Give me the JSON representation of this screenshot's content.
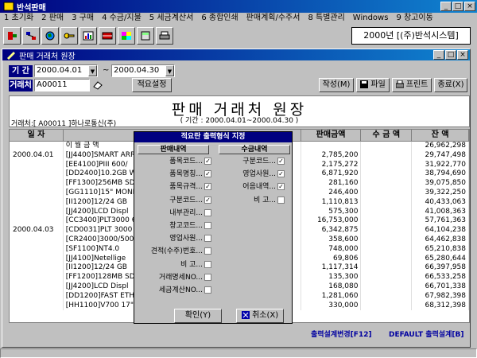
{
  "app": {
    "title": "반석판매"
  },
  "menu": [
    "1 초기화",
    "2 판매",
    "3 구매",
    "4 수금/지불",
    "5 세금계산서",
    "6 종합인쇄",
    "판매계획/수주서",
    "8 특별관리",
    "Windows",
    "9 창고이동"
  ],
  "toolbar_icons": [
    "exit-icon",
    "network-icon",
    "globe-icon",
    "key-icon",
    "chart-icon",
    "register-icon",
    "puzzle-icon",
    "calculator-icon",
    "printer-icon"
  ],
  "company": "2000년 [(주)반석시스템]",
  "window": {
    "title": "판매 거래처 원장"
  },
  "filter": {
    "period_label": "기 간",
    "customer_label": "거래처",
    "date_from": "2000.04.01",
    "tilde": "~",
    "date_to": "2000.04.30",
    "customer_code": "A00011",
    "summary_button": "적요설정"
  },
  "actions": {
    "create": "작성(M)",
    "file": "파일",
    "print": "프린트",
    "exit": "종료(X)"
  },
  "report": {
    "title": "판매 거래처 원장",
    "subtitle": "( 기간 : 2000.04.01~2000.04.30 )",
    "customer": "거래처:[ A00011 ]하나로통신(주)"
  },
  "grid": {
    "headers": [
      "일 자",
      "",
      "판매금액",
      "수 금 액",
      "잔 액"
    ],
    "rows": [
      {
        "date": "",
        "desc": "이 월 금 액",
        "sale": "",
        "paid": "",
        "balance": "26,962,298"
      },
      {
        "date": "2000.04.01",
        "desc": "[JJ4400]SMART ARR",
        "sale": "2,785,200",
        "paid": "",
        "balance": "29,747,498"
      },
      {
        "date": "",
        "desc": "[EE4100]PIII 600/",
        "sale": "2,175,272",
        "paid": "",
        "balance": "31,922,770"
      },
      {
        "date": "",
        "desc": "[DD2400]10.2GB WUL",
        "sale": "6,871,920",
        "paid": "",
        "balance": "38,794,690"
      },
      {
        "date": "",
        "desc": "[FF1300]256MB SDR",
        "sale": "281,160",
        "paid": "",
        "balance": "39,075,850"
      },
      {
        "date": "",
        "desc": "[GG1110]15\" MONIT",
        "sale": "246,400",
        "paid": "",
        "balance": "39,322,250"
      },
      {
        "date": "",
        "desc": "[II1200]12/24 GB",
        "sale": "1,110,813",
        "paid": "",
        "balance": "40,433,063"
      },
      {
        "date": "",
        "desc": "[JJ4200]LCD Displ",
        "sale": "575,300",
        "paid": "",
        "balance": "41,008,363"
      },
      {
        "date": "",
        "desc": "[CC3400]PLT3000 6",
        "sale": "16,753,000",
        "paid": "",
        "balance": "57,761,363"
      },
      {
        "date": "2000.04.03",
        "desc": "[CD0031]PLT 3000",
        "sale": "6,342,875",
        "paid": "",
        "balance": "64,104,238"
      },
      {
        "date": "",
        "desc": "[CR2400]3000/5000",
        "sale": "358,600",
        "paid": "",
        "balance": "64,462,838"
      },
      {
        "date": "",
        "desc": "[SF1100]NT4.0",
        "sale": "748,000",
        "paid": "",
        "balance": "65,210,838"
      },
      {
        "date": "",
        "desc": "[JJ4100]Netellige",
        "sale": "69,806",
        "paid": "",
        "balance": "65,280,644"
      },
      {
        "date": "",
        "desc": "[II1200]12/24 GB",
        "sale": "1,117,314",
        "paid": "",
        "balance": "66,397,958"
      },
      {
        "date": "",
        "desc": "[FF1200]128MB SDR",
        "sale": "135,300",
        "paid": "",
        "balance": "66,533,258"
      },
      {
        "date": "",
        "desc": "[JJ4200]LCD Displ",
        "sale": "168,080",
        "paid": "",
        "balance": "66,701,338"
      },
      {
        "date": "",
        "desc": "[DD1200]FAST ETHE",
        "sale": "1,281,060",
        "paid": "",
        "balance": "67,982,398"
      },
      {
        "date": "",
        "desc": "[HH1100]V700 17\"",
        "sale": "330,000",
        "paid": "",
        "balance": "68,312,398"
      }
    ]
  },
  "footer": {
    "left": "출력설계변경[F12]",
    "right": "DEFAULT 출력설계[B]"
  },
  "dialog": {
    "title": "적요란 출력형식 지정",
    "left_section": "판매내역",
    "right_section": "수금내역",
    "left_options": [
      {
        "label": "품목코드...",
        "checked": true
      },
      {
        "label": "품목명칭...",
        "checked": true
      },
      {
        "label": "품목규격...",
        "checked": true
      },
      {
        "label": "구분코드...",
        "checked": true
      },
      {
        "label": "내부관리...",
        "checked": false
      },
      {
        "label": "창고코드...",
        "checked": false
      },
      {
        "label": "영업사원...",
        "checked": false
      },
      {
        "label": "견적(수주)번호...",
        "checked": false
      },
      {
        "label": "비 고...",
        "checked": false
      },
      {
        "label": "거래명세NO...",
        "checked": false
      },
      {
        "label": "세금계산NO...",
        "checked": false
      }
    ],
    "right_options": [
      {
        "label": "구분코드...",
        "checked": true
      },
      {
        "label": "영업사원...",
        "checked": true
      },
      {
        "label": "어음내역...",
        "checked": true
      },
      {
        "label": "비 고...",
        "checked": false
      }
    ],
    "ok": "확인(Y)",
    "cancel": "취소(X)",
    "check_mark": "✓"
  },
  "colors": {
    "accent": "#000080",
    "footer_text": "#0000a0"
  }
}
